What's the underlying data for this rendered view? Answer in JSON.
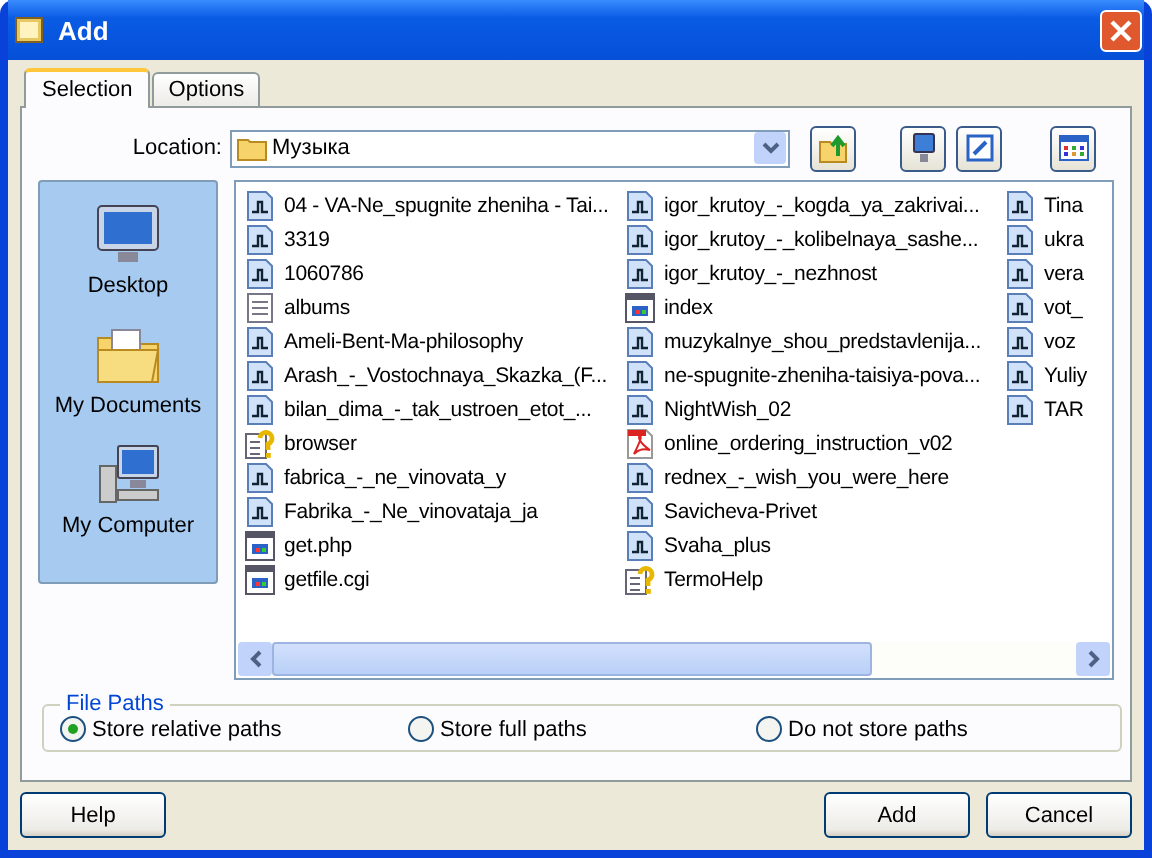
{
  "window": {
    "title": "Add"
  },
  "tabs": [
    {
      "label": "Selection",
      "selected": true
    },
    {
      "label": "Options",
      "selected": false
    }
  ],
  "location": {
    "label": "Location:",
    "value": "Музыка"
  },
  "places": [
    {
      "label": "Desktop",
      "kind": "desktop"
    },
    {
      "label": "My Documents",
      "kind": "documents"
    },
    {
      "label": "My Computer",
      "kind": "computer"
    }
  ],
  "file_columns": [
    {
      "items": [
        {
          "name": "04 - VA-Ne_spugnite zheniha - Tai...",
          "kind": "audio"
        },
        {
          "name": "3319",
          "kind": "audio"
        },
        {
          "name": "1060786",
          "kind": "audio"
        },
        {
          "name": "albums",
          "kind": "text"
        },
        {
          "name": "Ameli-Bent-Ma-philosophy",
          "kind": "audio"
        },
        {
          "name": "Arash_-_Vostochnaya_Skazka_(F...",
          "kind": "audio"
        },
        {
          "name": "bilan_dima_-_tak_ustroen_etot_...",
          "kind": "audio"
        },
        {
          "name": "browser",
          "kind": "help"
        },
        {
          "name": "fabrica_-_ne_vinovata_y",
          "kind": "audio"
        },
        {
          "name": "Fabrika_-_Ne_vinovataja_ja",
          "kind": "audio"
        },
        {
          "name": "get.php",
          "kind": "web"
        },
        {
          "name": "getfile.cgi",
          "kind": "web"
        }
      ]
    },
    {
      "items": [
        {
          "name": "igor_krutoy_-_kogda_ya_zakrivai...",
          "kind": "audio"
        },
        {
          "name": "igor_krutoy_-_kolibelnaya_sashe...",
          "kind": "audio"
        },
        {
          "name": "igor_krutoy_-_nezhnost",
          "kind": "audio"
        },
        {
          "name": "index",
          "kind": "web"
        },
        {
          "name": "muzykalnye_shou_predstavlenija...",
          "kind": "audio"
        },
        {
          "name": "ne-spugnite-zheniha-taisiya-pova...",
          "kind": "audio"
        },
        {
          "name": "NightWish_02",
          "kind": "audio"
        },
        {
          "name": "online_ordering_instruction_v02",
          "kind": "pdf"
        },
        {
          "name": "rednex_-_wish_you_were_here",
          "kind": "audio"
        },
        {
          "name": "Savicheva-Privet",
          "kind": "audio"
        },
        {
          "name": "Svaha_plus",
          "kind": "audio"
        },
        {
          "name": "TermoHelp",
          "kind": "help"
        }
      ]
    },
    {
      "items": [
        {
          "name": "Tina",
          "kind": "audio"
        },
        {
          "name": "ukra",
          "kind": "audio"
        },
        {
          "name": "vera",
          "kind": "audio"
        },
        {
          "name": "vot_",
          "kind": "audio"
        },
        {
          "name": "voz",
          "kind": "audio"
        },
        {
          "name": "Yuliy",
          "kind": "audio"
        },
        {
          "name": "TAR",
          "kind": "audio"
        }
      ]
    }
  ],
  "file_paths": {
    "title": "File Paths",
    "options": [
      {
        "label": "Store relative paths",
        "selected": true
      },
      {
        "label": "Store full paths",
        "selected": false
      },
      {
        "label": "Do not store paths",
        "selected": false
      }
    ]
  },
  "buttons": {
    "left": [
      "Help"
    ],
    "right": [
      "Add",
      "Cancel"
    ]
  }
}
